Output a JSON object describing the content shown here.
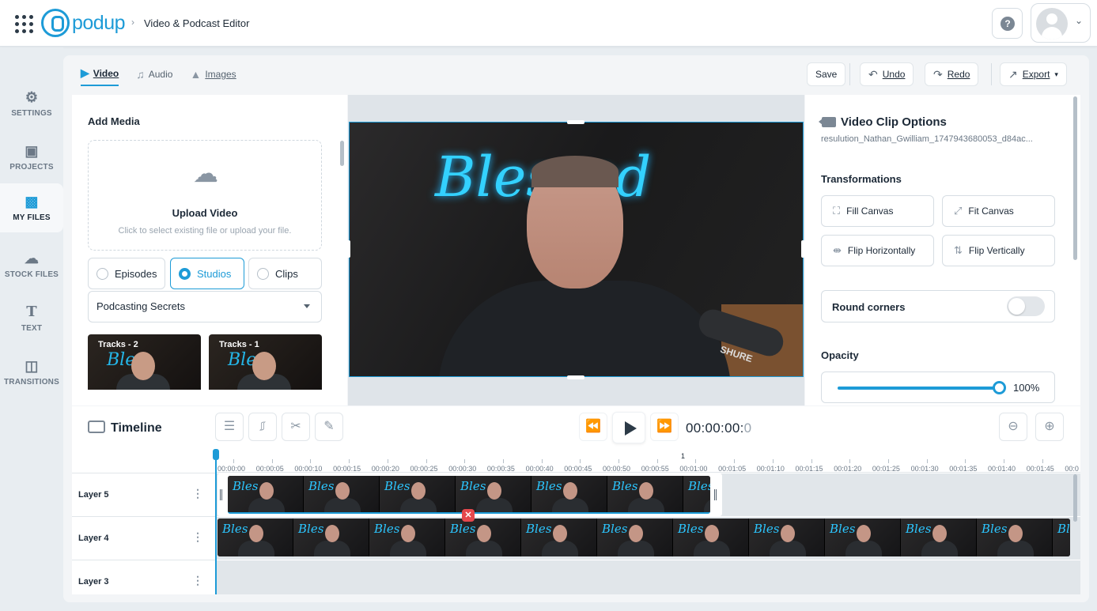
{
  "header": {
    "brand": "podup",
    "breadcrumb": "Video & Podcast Editor",
    "help_icon": "question-icon"
  },
  "sidebar": {
    "items": [
      {
        "label": "SETTINGS",
        "icon": "gear-icon"
      },
      {
        "label": "PROJECTS",
        "icon": "projects-icon"
      },
      {
        "label": "MY FILES",
        "icon": "files-icon",
        "active": true
      },
      {
        "label": "STOCK FILES",
        "icon": "cloud-icon"
      },
      {
        "label": "TEXT",
        "icon": "text-icon"
      },
      {
        "label": "TRANSITIONS",
        "icon": "transitions-icon"
      }
    ]
  },
  "media_tabs": [
    {
      "label": "Video",
      "active": true
    },
    {
      "label": "Audio"
    },
    {
      "label": "Images"
    }
  ],
  "actions": {
    "save": "Save",
    "undo": "Undo",
    "redo": "Redo",
    "export": "Export"
  },
  "add_media": {
    "title": "Add Media",
    "upload_title": "Upload Video",
    "upload_sub": "Click to select existing file or upload your file.",
    "sources": [
      "Episodes",
      "Studios",
      "Clips"
    ],
    "selected_source": "Studios",
    "studio_select": "Podcasting Secrets",
    "tracks": [
      "Tracks - 2",
      "Tracks - 1"
    ]
  },
  "clip_options": {
    "title": "Video Clip Options",
    "filename": "resulution_Nathan_Gwilliam_1747943680053_d84ac...",
    "transformations_label": "Transformations",
    "transform_buttons": [
      "Fill Canvas",
      "Fit Canvas",
      "Flip Horizontally",
      "Flip Vertically"
    ],
    "round_corners_label": "Round corners",
    "round_corners_on": false,
    "opacity_label": "Opacity",
    "opacity_value": "100%",
    "opacity_fraction": 1.0
  },
  "timeline": {
    "title": "Timeline",
    "time": "00:00:00:",
    "time_last": "0",
    "ruler_marker": "1",
    "ticks": [
      "00:00:00",
      "00:00:05",
      "00:00:10",
      "00:00:15",
      "00:00:20",
      "00:00:25",
      "00:00:30",
      "00:00:35",
      "00:00:40",
      "00:00:45",
      "00:00:50",
      "00:00:55",
      "00:01:00",
      "00:01:05",
      "00:01:10",
      "00:01:15",
      "00:01:20",
      "00:01:25",
      "00:01:30",
      "00:01:35",
      "00:01:40",
      "00:01:45",
      "00:0"
    ],
    "layers": [
      "Layer 5",
      "Layer 4",
      "Layer 3"
    ],
    "delete_glyph": "✕"
  },
  "colors": {
    "accent": "#1d9bd7",
    "delete": "#e5484d"
  }
}
